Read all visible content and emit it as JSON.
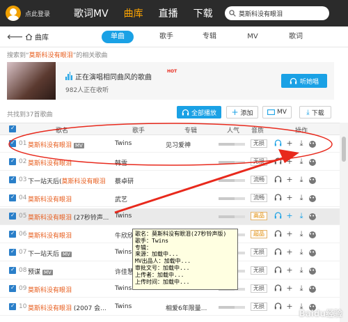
{
  "topbar": {
    "login": "点此登录",
    "tabs": [
      {
        "label": "歌词MV",
        "active": false
      },
      {
        "label": "曲库",
        "active": true
      },
      {
        "label": "直播",
        "active": false
      },
      {
        "label": "下载",
        "active": false
      }
    ],
    "search_value": "莫斯科没有眼泪"
  },
  "subbar": {
    "home_label": "曲库",
    "tabs": [
      {
        "label": "单曲",
        "active": true
      },
      {
        "label": "歌手",
        "active": false
      },
      {
        "label": "专辑",
        "active": false
      },
      {
        "label": "MV",
        "active": false
      },
      {
        "label": "歌词",
        "active": false
      }
    ]
  },
  "hint": {
    "prefix": "搜索到“",
    "keyword": "莫斯科没有眼泪",
    "suffix": "”的相关歌曲"
  },
  "banner": {
    "title": "正在演唱相同曲风的歌曲",
    "hot": "HOT",
    "listeners": "982人正在收听",
    "button": "听她唱"
  },
  "list": {
    "count": "共找到37首歌曲",
    "play_all": "全部播放",
    "add": "添加",
    "mv": "MV",
    "download": "下载"
  },
  "columns": {
    "title": "歌名",
    "singer": "歌手",
    "album": "专辑",
    "popularity": "人气",
    "quality": "音质",
    "ops": "操作"
  },
  "songs": [
    {
      "num": "01",
      "pre": "",
      "kw": "莫斯科没有眼泪",
      "post": "",
      "mv": "MV",
      "singer": "Twins",
      "album": "见习爱神",
      "quality": "无损"
    },
    {
      "num": "02",
      "pre": "",
      "kw": "莫斯科没有眼泪",
      "post": "",
      "mv": "",
      "singer": "韩雪",
      "album": "",
      "quality": "无损"
    },
    {
      "num": "03",
      "pre": "下一站天后(",
      "kw": "莫斯科没有眼泪",
      "post": "",
      "mv": "",
      "singer": "蔡卓研",
      "album": "",
      "quality": "流畅"
    },
    {
      "num": "04",
      "pre": "",
      "kw": "莫斯科没有眼泪",
      "post": "",
      "mv": "",
      "singer": "武艺",
      "album": "",
      "quality": "流畅"
    },
    {
      "num": "05",
      "pre": "",
      "kw": "莫斯科没有眼泪",
      "post": " (27秒铃声...",
      "mv": "",
      "singer": "Twins",
      "album": "",
      "quality": "高品"
    },
    {
      "num": "06",
      "pre": "",
      "kw": "莫斯科没有眼泪",
      "post": "",
      "mv": "",
      "singer": "牛欣欣",
      "album": "",
      "quality": "超品"
    },
    {
      "num": "07",
      "pre": "下一站天后",
      "kw": "",
      "post": "",
      "mv": "MV",
      "singer": "Twins",
      "album": "",
      "quality": "无损"
    },
    {
      "num": "08",
      "pre": "预谋",
      "kw": "",
      "post": "",
      "mv": "MV",
      "singer": "许佳慧",
      "album": "",
      "quality": "无损"
    },
    {
      "num": "09",
      "pre": "",
      "kw": "莫斯科没有眼泪",
      "post": "",
      "mv": "",
      "singer": "Twins",
      "album": "",
      "quality": "无损"
    },
    {
      "num": "10",
      "pre": "",
      "kw": "莫斯科没有眼泪",
      "post": " (2007 会...",
      "mv": "",
      "singer": "Twins",
      "album": "相爱6年限量...",
      "quality": "无损"
    }
  ],
  "tooltip": [
    "歌名：莫斯科没有眼泪(27秒铃声版)",
    "歌手：Twins",
    "专辑：",
    "来源：加载中...",
    "MV出品人：加载中...",
    "审批文号：加载中...",
    "上传者：加载中...",
    "上传时间：加载中..."
  ],
  "watermark": "Baidu经验",
  "colors": {
    "accent": "#1aa1e5",
    "active_tab": "#ffa500",
    "keyword": "#e75d1d",
    "annotation": "#e8291c"
  }
}
